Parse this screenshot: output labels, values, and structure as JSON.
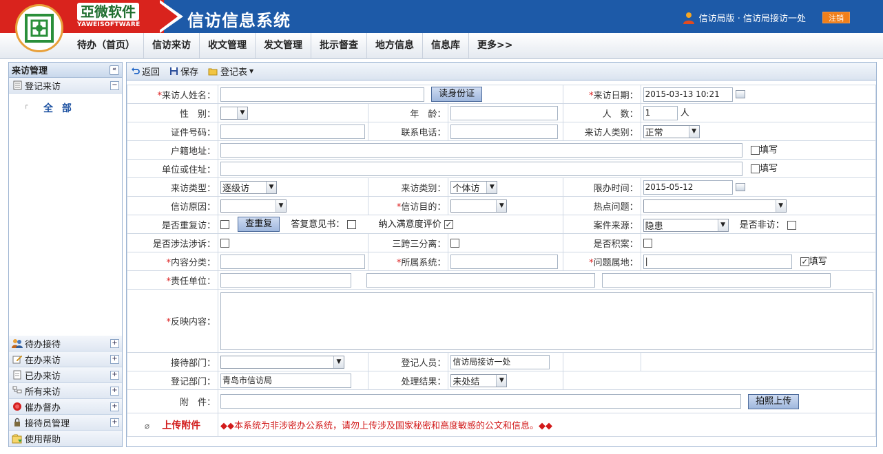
{
  "header": {
    "brand_cn": "亞微软件",
    "brand_en": "YAWEISOFTWARE",
    "system_title": "信访信息系统",
    "user_text": "信访局版 · 信访局接访一处",
    "logout": "注销"
  },
  "nav": [
    "待办（首页）",
    "信访来访",
    "收文管理",
    "发文管理",
    "批示督查",
    "地方信息",
    "信息库",
    "更多>>"
  ],
  "sidebar": {
    "title": "来访管理",
    "section": "登记来访",
    "all": "全 部",
    "items": [
      "待办接待",
      "在办来访",
      "已办来访",
      "所有来访",
      "催办督办",
      "接待员管理",
      "使用帮助"
    ]
  },
  "toolbar": {
    "back": "返回",
    "save": "保存",
    "register": "登记表"
  },
  "form": {
    "visitor_name": "来访人姓名：",
    "read_id": "读身份证",
    "visit_date_label": "来访日期：",
    "visit_date": "2015-03-13 10:21",
    "gender": "性　别：",
    "age": "年　龄：",
    "people_count_label": "人　数：",
    "people_count": "1",
    "people_unit": "人",
    "id_no": "证件号码：",
    "phone": "联系电话：",
    "visitor_type_label": "来访人类别：",
    "visitor_type": "正常",
    "hukou": "户籍地址：",
    "fill": "填写",
    "work_address": "单位或住址：",
    "visit_kind_label": "来访类型：",
    "visit_kind": "逐级访",
    "visit_category_label": "来访类别：",
    "visit_category": "个体访",
    "deadline_label": "限办时间：",
    "deadline": "2015-05-12",
    "reason": "信访原因：",
    "purpose": "信访目的：",
    "hot_issue": "热点问题：",
    "repeat": "是否重复访：",
    "check_repeat": "查重复",
    "reply_opinion": "答复意见书：",
    "satisfaction": "纳入满意度评价",
    "case_source_label": "案件来源：",
    "case_source": "隐患",
    "illegal_visit": "是否非访：",
    "law_related": "是否涉法涉诉：",
    "three_cross": "三跨三分离：",
    "backlog": "是否积案：",
    "content_class": "内容分类：",
    "belong_system": "所属系统：",
    "issue_location": "问题属地：",
    "responsible": "责任单位：",
    "content": "反映内容：",
    "reception_dept": "接待部门：",
    "registrar_label": "登记人员：",
    "registrar": "信访局接访一处",
    "reg_dept_label": "登记部门：",
    "reg_dept": "青岛市信访局",
    "result_label": "处理结果：",
    "result": "未处结",
    "attachment": "附　件：",
    "photo_upload": "拍照上传",
    "upload_attachment": "上传附件",
    "notice": "◆◆本系统为非涉密办公系统，请勿上传涉及国家秘密和高度敏感的公文和信息。◆◆"
  }
}
